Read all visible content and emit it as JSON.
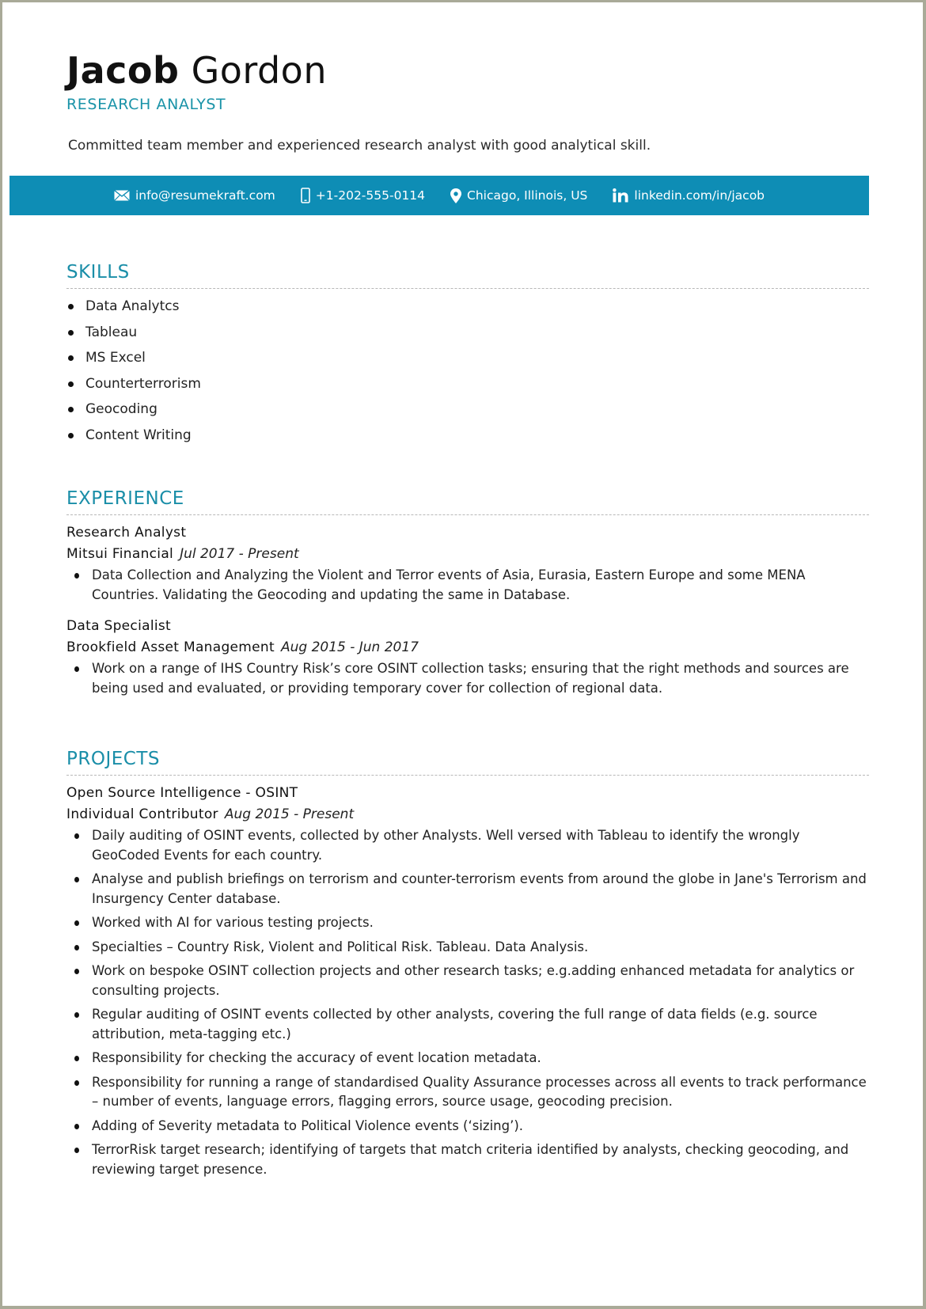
{
  "header": {
    "first_name": "Jacob",
    "last_name": "Gordon",
    "job_title": "RESEARCH ANALYST",
    "summary": "Committed team member and experienced research analyst with good analytical skill."
  },
  "contact": {
    "bar_color": "#0e8db5",
    "items": [
      {
        "icon": "envelope-icon",
        "label": "info@resumekraft.com"
      },
      {
        "icon": "mobile-phone-icon",
        "label": "+1-202-555-0114"
      },
      {
        "icon": "map-pin-icon",
        "label": "Chicago, Illinois, US"
      },
      {
        "icon": "linkedin-icon",
        "label": "linkedin.com/in/jacob"
      }
    ]
  },
  "accent_color": "#1a8ea8",
  "skills": {
    "title": "SKILLS",
    "items": [
      "Data Analytcs",
      "Tableau",
      "MS Excel",
      "Counterterrorism",
      "Geocoding",
      "Content Writing"
    ]
  },
  "experience": {
    "title": "EXPERIENCE",
    "entries": [
      {
        "role": "Research Analyst",
        "organization": "Mitsui Financial",
        "dates": "Jul 2017 - Present",
        "bullets": [
          "Data Collection and Analyzing the Violent and Terror events of Asia, Eurasia, Eastern Europe and some MENA Countries. Validating the Geocoding and updating the same in Database."
        ]
      },
      {
        "role": "Data Specialist",
        "organization": "Brookfield Asset Management",
        "dates": "Aug 2015 - Jun 2017",
        "bullets": [
          "Work on a range of IHS Country Risk’s core OSINT collection tasks; ensuring that the right methods and sources are being used and evaluated, or providing temporary cover for collection of regional data."
        ]
      }
    ]
  },
  "projects": {
    "title": "PROJECTS",
    "entries": [
      {
        "name": "Open Source Intelligence - OSINT",
        "role": "Individual Contributor",
        "dates": "Aug 2015 - Present",
        "bullets": [
          "Daily auditing of OSINT events, collected by other Analysts. Well versed with Tableau to identify the wrongly GeoCoded Events for each country.",
          "Analyse and publish briefings on terrorism and counter-terrorism events from around the globe in Jane's Terrorism and Insurgency Center database.",
          "Worked with AI for various testing projects.",
          "Specialties – Country Risk, Violent and Political Risk. Tableau. Data Analysis.",
          "Work on bespoke OSINT collection projects and other research tasks; e.g.adding enhanced metadata for analytics or consulting projects.",
          "Regular auditing of OSINT events collected by other analysts, covering the full range of data fields (e.g. source attribution, meta-tagging etc.)",
          "Responsibility for checking the accuracy of event location metadata.",
          "Responsibility for running a range of standardised Quality Assurance processes across all events to track performance – number of events, language errors, flagging errors, source usage, geocoding precision.",
          "Adding of Severity metadata to Political Violence events (‘sizing’).",
          "TerrorRisk target research; identifying of targets that match criteria identified by analysts, checking geocoding, and reviewing target presence."
        ]
      }
    ]
  }
}
